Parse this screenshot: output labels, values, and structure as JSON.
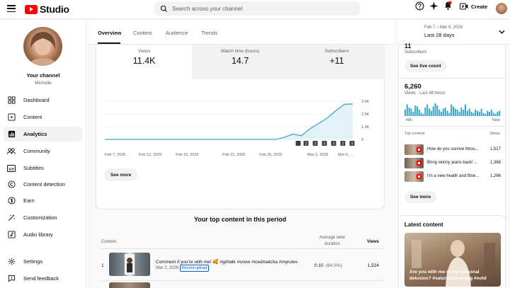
{
  "topbar": {
    "app_name": "Studio",
    "search_placeholder": "Search across your channel",
    "create_label": "Create",
    "colors": {
      "brand_red": "#ff0000"
    }
  },
  "sidebar": {
    "channel_title": "Your channel",
    "channel_name": "Michelle",
    "items": [
      {
        "label": "Dashboard",
        "icon": "dashboard-icon"
      },
      {
        "label": "Content",
        "icon": "content-icon"
      },
      {
        "label": "Analytics",
        "icon": "analytics-icon",
        "active": true
      },
      {
        "label": "Community",
        "icon": "community-icon"
      },
      {
        "label": "Subtitles",
        "icon": "subtitles-icon"
      },
      {
        "label": "Content detection",
        "icon": "copyright-icon"
      },
      {
        "label": "Earn",
        "icon": "dollar-icon"
      },
      {
        "label": "Customization",
        "icon": "wand-icon"
      },
      {
        "label": "Audio library",
        "icon": "audio-library-icon"
      },
      {
        "label": "Settings",
        "icon": "gear-icon"
      },
      {
        "label": "Send feedback",
        "icon": "feedback-icon"
      }
    ]
  },
  "tabs": [
    "Overview",
    "Content",
    "Audience",
    "Trends"
  ],
  "date_range": {
    "range": "Feb 7 – Mar 6, 2026",
    "label": "Last 28 days"
  },
  "stats": [
    {
      "label": "Views",
      "value": "11.4K"
    },
    {
      "label": "Watch time (hours)",
      "value": "14.7"
    },
    {
      "label": "Subscribers",
      "value": "+11"
    }
  ],
  "chart_data": {
    "type": "area",
    "x": [
      "Feb 7, 2026",
      "Feb 12, 2026",
      "Feb 16, 2026",
      "Feb 21, 2026",
      "Feb 25, 2026",
      "Mar 2, 2026",
      "Mar 6, ..."
    ],
    "x_ticks": [
      "Feb 7, 2026",
      "Feb 12, 2026",
      "Feb 16, 2026",
      "Feb 21, 2026",
      "Feb 25, 2026",
      "Mar 2, 2026",
      "Mar 6, ..."
    ],
    "y_ticks": [
      "3.6K",
      "2.5K",
      "1.3K",
      "0"
    ],
    "ylim": [
      0,
      3600
    ],
    "series": [
      {
        "values": [
          0,
          0,
          0,
          0,
          0,
          0,
          0,
          0,
          0,
          0,
          0,
          0,
          0,
          0,
          0,
          0,
          0,
          0,
          0,
          0,
          0,
          200,
          500,
          350,
          1000,
          1500,
          2000,
          2700,
          3300,
          3350
        ]
      }
    ],
    "upload_markers": [
      "",
      "2",
      "3",
      "3",
      "3",
      "3",
      "3"
    ],
    "grid": true,
    "color": "#3ea6c8",
    "fill": "#e3f1f8"
  },
  "see_more_label": "See more",
  "top_content": {
    "heading": "Your top content in this period",
    "columns": {
      "content": "Content",
      "avg_view_duration": "Average view duration",
      "views": "Views"
    },
    "rows": [
      {
        "rank": "1",
        "title": "Comment if you're with me! 🥰 #girltalk #snow #icedmatcha #myrules",
        "date": "Mar 2, 2026",
        "badge": "Recent upload",
        "duration": "0:10",
        "duration_pct": "(64.5%)",
        "views": "1,524"
      }
    ]
  },
  "realtime": {
    "subscribers_value": "11",
    "subscribers_label": "Subscribers",
    "live_count_label": "See live count",
    "views_value": "6,260",
    "views_label": "Views · Last 48 hours",
    "axis_start": "-48h",
    "axis_end": "Now",
    "bars": [
      30,
      55,
      40,
      35,
      20,
      50,
      45,
      30,
      15,
      10,
      40,
      55,
      35,
      25,
      45,
      60,
      50,
      30,
      20,
      35,
      40,
      25,
      15,
      55,
      45,
      35,
      30,
      20,
      40,
      30,
      55,
      25,
      35,
      20,
      15,
      30,
      25,
      20,
      35,
      15,
      10,
      25,
      20,
      30,
      15,
      10,
      20,
      25
    ],
    "top_content_label": "Top content",
    "views_col_label": "Views",
    "top_items": [
      {
        "title": "How do you survive throu...",
        "views": "1,517"
      },
      {
        "title": "Bring skinny jeans back! ...",
        "views": "1,368"
      },
      {
        "title": "I'm a new health and fitne...",
        "views": "1,266"
      }
    ],
    "see_more_label": "See more"
  },
  "latest": {
    "heading": "Latest content",
    "title": "Are you with me in my seasonal delusion? #saturdaymorning #ootd #girltalk..."
  }
}
